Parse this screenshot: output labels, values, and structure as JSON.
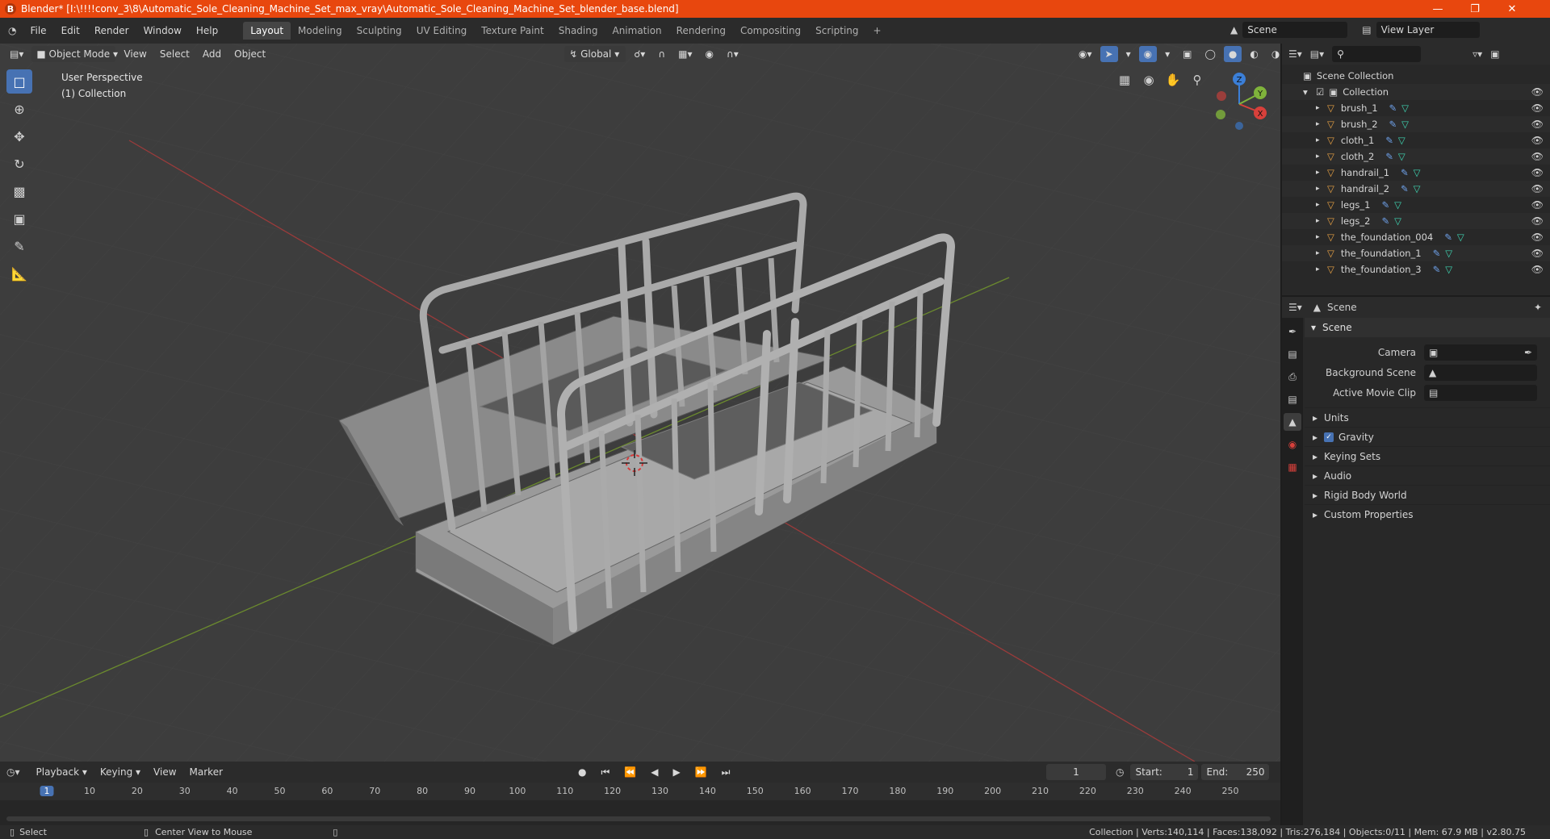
{
  "titlebar": {
    "title": "Blender* [I:\\!!!!conv_3\\8\\Automatic_Sole_Cleaning_Machine_Set_max_vray\\Automatic_Sole_Cleaning_Machine_Set_blender_base.blend]"
  },
  "menus": [
    "File",
    "Edit",
    "Render",
    "Window",
    "Help"
  ],
  "workspaces": [
    "Layout",
    "Modeling",
    "Sculpting",
    "UV Editing",
    "Texture Paint",
    "Shading",
    "Animation",
    "Rendering",
    "Compositing",
    "Scripting"
  ],
  "active_workspace": "Layout",
  "scene_name": "Scene",
  "view_layer": "View Layer",
  "viewport": {
    "mode": "Object Mode",
    "menu": [
      "View",
      "Select",
      "Add",
      "Object"
    ],
    "orientation": "Global",
    "info_line1": "User Perspective",
    "info_line2": "(1) Collection",
    "gizmo": {
      "x": "X",
      "y": "Y",
      "z": "Z"
    }
  },
  "outliner": {
    "root": "Scene Collection",
    "collection": "Collection",
    "items": [
      "brush_1",
      "brush_2",
      "cloth_1",
      "cloth_2",
      "handrail_1",
      "handrail_2",
      "legs_1",
      "legs_2",
      "the_foundation_004",
      "the_foundation_1",
      "the_foundation_3"
    ]
  },
  "properties": {
    "header": "Scene",
    "panel": "Scene",
    "camera_label": "Camera",
    "background_label": "Background Scene",
    "movie_label": "Active Movie Clip",
    "subpanels": [
      "Units",
      "Gravity",
      "Keying Sets",
      "Audio",
      "Rigid Body World",
      "Custom Properties"
    ]
  },
  "timeline": {
    "menus": [
      "Playback",
      "Keying",
      "View",
      "Marker"
    ],
    "current_frame": "1",
    "start_label": "Start:",
    "start": "1",
    "end_label": "End:",
    "end": "250",
    "ticks": [
      "1",
      "10",
      "20",
      "30",
      "40",
      "50",
      "60",
      "70",
      "80",
      "90",
      "100",
      "110",
      "120",
      "130",
      "140",
      "150",
      "160",
      "170",
      "180",
      "190",
      "200",
      "210",
      "220",
      "230",
      "240",
      "250"
    ]
  },
  "statusbar": {
    "select": "Select",
    "center": "Center View to Mouse",
    "stats": "Collection | Verts:140,114 | Faces:138,092 | Tris:276,184 | Objects:0/11 | Mem: 67.9 MB | v2.80.75"
  },
  "colors": {
    "accent": "#4772b3",
    "titlebar": "#e8470e",
    "object_icon": "#e9a244",
    "mesh_icon": "#3fd6b3"
  }
}
